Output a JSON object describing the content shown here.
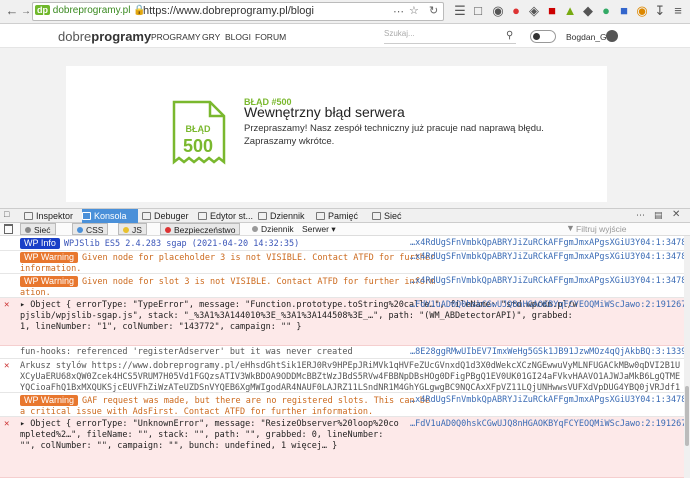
{
  "browser": {
    "site_identity": "dobreprogramy.pl",
    "url": "https://www.dobreprogramy.pl/blogi"
  },
  "site": {
    "logo_prefix": "dobre",
    "logo_bold": "programy",
    "nav": [
      "PROGRAMY",
      "GRY",
      "BLOGI",
      "FORUM"
    ],
    "search_placeholder": "Szukaj...",
    "username": "Bogdan_G"
  },
  "error_page": {
    "doc_label": "BŁĄD",
    "doc_code": "500",
    "code_label": "BŁĄD #500",
    "title": "Wewnętrzny błąd serwera",
    "message_1": "Przepraszamy! Nasz zespół techniczny już pracuje nad naprawą błędu.",
    "message_2": "Zapraszamy wkrótce.",
    "accent_color": "#7ab82e"
  },
  "devtools": {
    "tabs": [
      "Inspektor",
      "Konsola",
      "Debuger",
      "Edytor st...",
      "Dziennik",
      "Pamięć",
      "Sieć"
    ],
    "active_tab": "Konsola",
    "filters": [
      "Sieć",
      "CSS",
      "JS",
      "Bezpieczeństwo",
      "Dziennik",
      "Serwer"
    ],
    "filter_placeholder": "Filtruj wyjście"
  },
  "console": {
    "rows": [
      {
        "kind": "info",
        "badge": "WP Info",
        "text": "WPJSlib ES5 2.4.283 sgap (2021-04-20 14:32:35)",
        "src": "…x4RdUgSFnVmbkQpABRYJiZuRCkAFFgmJmxAPgsXGiU3Y04:1:347804"
      },
      {
        "kind": "warn",
        "badge": "WP Warning",
        "text": "Given node for placeholder 3 is not VISIBLE. Contact ATFD for further information.",
        "src": "…x4RdUgSFnVmbkQpABRYJiZuRCkAFFgmJmxAPgsXGiU3Y04:1:347804"
      },
      {
        "kind": "warn",
        "badge": "WP Warning",
        "text": "Given node for slot 3 is not VISIBLE. Contact ATFD for further information.",
        "src": "…x4RdUgSFnVmbkQpABRYJiZuRCkAFFgmJmxAPgsXGiU3Y04:1:347804"
      },
      {
        "kind": "err",
        "text": "▸ Object { errorType: \"TypeError\", message: \"Function.prototype.toString%20calle…\", fileName: \"std.wpcdn.pl/wpjslib/wpjslib-sgap.js\", stack: \"_%3A1%3A144010%3E_%3A1%3A144508%3E_…\", path: \"(WM_ABDetectorAPI)\", grabbed: 1, lineNumber: \"1\", colNumber: \"143772\", campaign: \"\" }",
        "src": "…FdV1uAD0Q0hskCGwUJQ8nHGAOKBYqFCYEOQMiWScJawo:2:191267"
      },
      {
        "kind": "plain",
        "text": "fun-hooks: referenced 'registerAdserver' but it was never created",
        "src": "…8E28ggRMwUIbEV7ImxWeHg5GSk1JB91JzwMOz4qQjAkbBQ:3:133920"
      },
      {
        "kind": "plain",
        "full": true,
        "text": "Arkusz stylów https://www.dobreprogramy.pl/eHhsdGhtSik1ERJ0Rv9HPEpJRiMVk1qHVFeZUcGVnxdQ1d3X0dWekcXCzNGEwwuVyMLNFUGACkMBw0qDVI2B1UXCyUaERU68xQW0Zcek4HCS5VRUM7H05Vd1FGQzsATIV3WkBDOA9ODDMcBBZtWzJBdS5RVw4FBBNpDBsHOg0DFigPBgQ1EV0UK01GI24aFVkvHAAVO1AJWJaMkB6LgQTMEYQCioaFhQ1BxMXQUKSjcEUVFhZiWzATeUZDSnVYQEB6XgMWIgodAR4NAUF0LAJRZ11LSndNR1M4GhYGLgwgBC9NQCAxXFpVZ11LQjUNHwwsVUFXdVpDUG4YBQ0jVRJdf15LAiFaRgRxWkVVcAkSBnANVQMqARBYIjBdFX",
        "src": ""
      },
      {
        "kind": "warn",
        "badge": "WP Warning",
        "text": "GAF request was made, but there are no registered slots. This can be a critical issue with AdsFirst. Contact ATFD for further information.",
        "src": "…x4RdUgSFnVmbkQpABRYJiZuRCkAFFgmJmxAPgsXGiU3Y04:1:347804"
      },
      {
        "kind": "err",
        "text": "▸ Object { errorType: \"UnknownError\", message: \"ResizeObserver%20loop%20completed%2…\", fileName: \"\", stack: \"\", path: \"\", grabbed: 0, lineNumber: \"\", colNumber: \"\", campaign: \"\", bunch: undefined, 1 więcej… }",
        "src": "…FdV1uAD0Q0hskCGwUJQ8nHGAOKBYqFCYEOQMiWScJawo:2:191267"
      }
    ]
  }
}
